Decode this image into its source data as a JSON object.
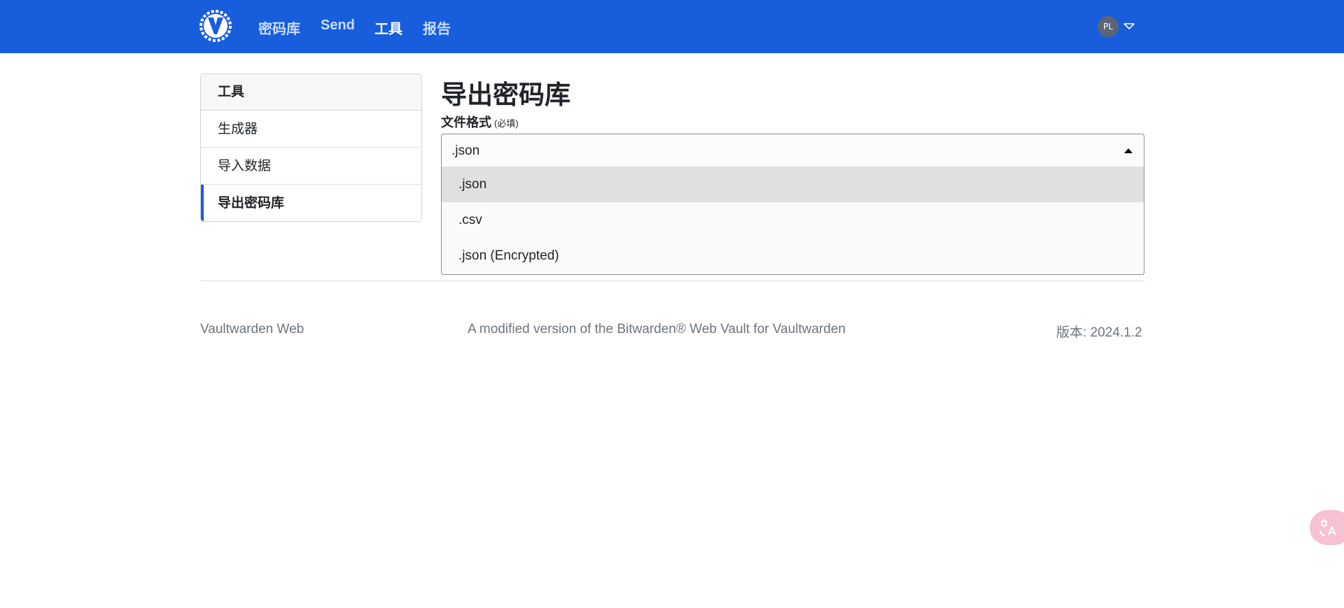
{
  "nav": {
    "items": [
      {
        "label": "密码库",
        "active": false
      },
      {
        "label": "Send",
        "active": false
      },
      {
        "label": "工具",
        "active": true
      },
      {
        "label": "报告",
        "active": false
      }
    ],
    "avatar_initials": "PL",
    "logo_icon": "vaultwarden-logo",
    "brand_color": "#175ddc"
  },
  "sidebar": {
    "header": "工具",
    "items": [
      {
        "label": "生成器",
        "active": false
      },
      {
        "label": "导入数据",
        "active": false
      },
      {
        "label": "导出密码库",
        "active": true
      }
    ]
  },
  "main": {
    "title": "导出密码库",
    "format_label": "文件格式",
    "required_hint": "(必填)",
    "selected_format": ".json",
    "options": [
      {
        "label": ".json",
        "highlighted": true
      },
      {
        "label": ".csv",
        "highlighted": false
      },
      {
        "label": ".json (Encrypted)",
        "highlighted": false
      }
    ]
  },
  "footer": {
    "left": "Vaultwarden Web",
    "center": "A modified version of the Bitwarden® Web Vault for Vaultwarden",
    "right": "版本: 2024.1.2"
  }
}
